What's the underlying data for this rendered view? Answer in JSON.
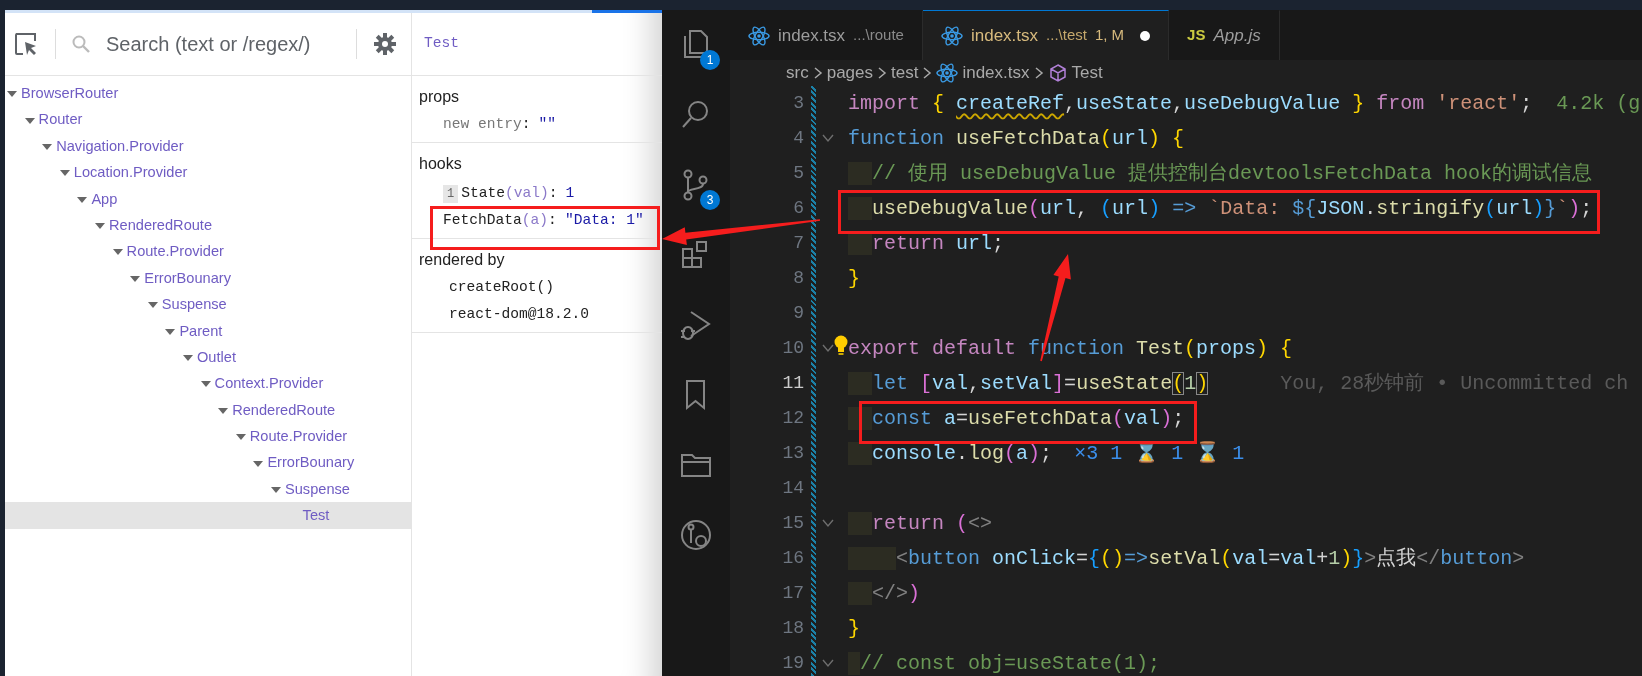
{
  "devtools": {
    "search": {
      "placeholder": "Search (text or /regex/)"
    },
    "tree": [
      {
        "label": "BrowserRouter",
        "expanded": true,
        "selected": false,
        "children": [
          {
            "label": "Router",
            "expanded": true,
            "selected": false,
            "children": [
              {
                "label": "Navigation.Provider",
                "expanded": true,
                "selected": false,
                "children": [
                  {
                    "label": "Location.Provider",
                    "expanded": true,
                    "selected": false,
                    "children": [
                      {
                        "label": "App",
                        "expanded": true,
                        "selected": false,
                        "children": [
                          {
                            "label": "RenderedRoute",
                            "expanded": true,
                            "selected": false,
                            "children": [
                              {
                                "label": "Route.Provider",
                                "expanded": true,
                                "selected": false,
                                "children": [
                                  {
                                    "label": "ErrorBounary",
                                    "expanded": true,
                                    "selected": false,
                                    "children": [
                                      {
                                        "label": "Suspense",
                                        "expanded": true,
                                        "selected": false,
                                        "children": [
                                          {
                                            "label": "Parent",
                                            "expanded": true,
                                            "selected": false,
                                            "children": [
                                              {
                                                "label": "Outlet",
                                                "expanded": true,
                                                "selected": false,
                                                "children": [
                                                  {
                                                    "label": "Context.Provider",
                                                    "expanded": true,
                                                    "selected": false,
                                                    "children": [
                                                      {
                                                        "label": "RenderedRoute",
                                                        "expanded": true,
                                                        "selected": false,
                                                        "children": [
                                                          {
                                                            "label": "Route.Provider",
                                                            "expanded": true,
                                                            "selected": false,
                                                            "children": [
                                                              {
                                                                "label": "ErrorBounary",
                                                                "expanded": true,
                                                                "selected": false,
                                                                "children": [
                                                                  {
                                                                    "label": "Suspense",
                                                                    "expanded": true,
                                                                    "selected": false,
                                                                    "children": [
                                                                      {
                                                                        "label": "Test",
                                                                        "selected": true
                                                                      }
                                                                    ]
                                                                  }
                                                                ]
                                                              }
                                                            ]
                                                          }
                                                        ]
                                                      }
                                                    ]
                                                  }
                                                ]
                                              }
                                            ]
                                          }
                                        ]
                                      }
                                    ]
                                  }
                                ]
                              }
                            ]
                          }
                        ]
                      }
                    ]
                  }
                ]
              }
            ]
          }
        ]
      }
    ],
    "inspector": {
      "component": "Test",
      "sections": [
        {
          "title": "props",
          "rows": [
            {
              "kind": "prop",
              "key": "new entry",
              "sep": ":",
              "value": "\"\""
            }
          ]
        },
        {
          "title": "hooks",
          "rows": [
            {
              "kind": "hook",
              "index": "1",
              "name": "State",
              "arg": "(val)",
              "sep": ":",
              "value": "1"
            },
            {
              "kind": "hook",
              "name": "FetchData",
              "arg": "(a)",
              "sep": ":",
              "value": "\"Data: 1\""
            }
          ]
        },
        {
          "title": "rendered by",
          "rows": [
            {
              "kind": "owner",
              "text": "createRoot()"
            },
            {
              "kind": "owner",
              "text": "react-dom@18.2.0"
            }
          ]
        }
      ]
    }
  },
  "editor": {
    "activity_bar": [
      {
        "kind": "files",
        "badge": "1"
      },
      {
        "kind": "search"
      },
      {
        "kind": "source-control",
        "badge": "3"
      },
      {
        "kind": "extensions"
      },
      {
        "kind": "debug"
      },
      {
        "kind": "bookmark"
      },
      {
        "kind": "folder"
      },
      {
        "kind": "git-graph"
      }
    ],
    "tabs": [
      {
        "icon": {
          "kind": "react"
        },
        "label": "index.tsx",
        "description": "...\\route",
        "selected": false,
        "preview": false,
        "dirty": false
      },
      {
        "icon": {
          "kind": "react"
        },
        "label": "index.tsx",
        "description": "...\\test",
        "status": "1, M",
        "selected": true,
        "preview": false,
        "dirty": true
      },
      {
        "icon": {
          "kind": "js",
          "text": "JS"
        },
        "label": "App.js",
        "selected": false,
        "preview": true,
        "dirty": false
      }
    ],
    "breadcrumb": [
      {
        "kind": "folder",
        "label": "src"
      },
      {
        "kind": "folder",
        "label": "pages"
      },
      {
        "kind": "folder",
        "label": "test"
      },
      {
        "kind": "file",
        "label": "index.tsx"
      },
      {
        "kind": "symbol",
        "label": "Test"
      }
    ],
    "lines": [
      {
        "number": "3",
        "tokens": [
          {
            "kind": "kw",
            "text": "import "
          },
          {
            "kind": "b1",
            "text": "{ "
          },
          {
            "kind": "unused",
            "text": "createRef"
          },
          {
            "kind": "p",
            "text": ","
          },
          {
            "kind": "var",
            "text": "useState"
          },
          {
            "kind": "p",
            "text": ","
          },
          {
            "kind": "var",
            "text": "useDebugValue "
          },
          {
            "kind": "b1",
            "text": "} "
          },
          {
            "kind": "kw",
            "text": "from "
          },
          {
            "kind": "str",
            "text": "'react'"
          },
          {
            "kind": "p",
            "text": ";"
          }
        ],
        "hint": {
          "kind": "size",
          "text": "4.2k (g"
        }
      },
      {
        "number": "4",
        "foldable": true,
        "tokens": [
          {
            "kind": "st",
            "text": "function "
          },
          {
            "kind": "fn",
            "text": "useFetchData"
          },
          {
            "kind": "b1",
            "text": "("
          },
          {
            "kind": "var",
            "text": "url"
          },
          {
            "kind": "b1",
            "text": ") {"
          }
        ]
      },
      {
        "number": "5",
        "tokens": [
          {
            "kind": "cm",
            "text": "  // 使用 useDebugValue 提供控制台devtoolsFetchData hook的调试信息"
          }
        ]
      },
      {
        "number": "6",
        "tokens": [
          {
            "kind": "fn",
            "text": "  useDebugValue"
          },
          {
            "kind": "b2",
            "text": "("
          },
          {
            "kind": "var",
            "text": "url"
          },
          {
            "kind": "p",
            "text": ", "
          },
          {
            "kind": "b3",
            "text": "("
          },
          {
            "kind": "var",
            "text": "url"
          },
          {
            "kind": "b3",
            "text": ") "
          },
          {
            "kind": "st",
            "text": "=> "
          },
          {
            "kind": "str",
            "text": "`Data: "
          },
          {
            "kind": "st",
            "text": "${"
          },
          {
            "kind": "var",
            "text": "JSON"
          },
          {
            "kind": "p",
            "text": "."
          },
          {
            "kind": "fn",
            "text": "stringify"
          },
          {
            "kind": "b3",
            "text": "("
          },
          {
            "kind": "var",
            "text": "url"
          },
          {
            "kind": "b3",
            "text": ")"
          },
          {
            "kind": "st",
            "text": "}"
          },
          {
            "kind": "str",
            "text": "`"
          },
          {
            "kind": "b2",
            "text": ")"
          },
          {
            "kind": "p",
            "text": ";"
          }
        ]
      },
      {
        "number": "7",
        "tokens": [
          {
            "kind": "kw",
            "text": "  return "
          },
          {
            "kind": "var",
            "text": "url"
          },
          {
            "kind": "p",
            "text": ";"
          }
        ]
      },
      {
        "number": "8",
        "tokens": [
          {
            "kind": "b1",
            "text": "}"
          }
        ]
      },
      {
        "number": "9"
      },
      {
        "number": "10",
        "foldable": true,
        "lightbulb": true,
        "tokens": [
          {
            "kind": "kw",
            "text": "export default "
          },
          {
            "kind": "st",
            "text": "function "
          },
          {
            "kind": "fn",
            "text": "Test"
          },
          {
            "kind": "b1",
            "text": "("
          },
          {
            "kind": "var",
            "text": "props"
          },
          {
            "kind": "b1",
            "text": ") {"
          }
        ]
      },
      {
        "number": "11",
        "current": true,
        "tokens": [
          {
            "kind": "st",
            "text": "  let "
          },
          {
            "kind": "b2",
            "text": "["
          },
          {
            "kind": "var",
            "text": "val"
          },
          {
            "kind": "p",
            "text": ","
          },
          {
            "kind": "var",
            "text": "setVal"
          },
          {
            "kind": "b2",
            "text": "]"
          },
          {
            "kind": "p",
            "text": "="
          },
          {
            "kind": "fn",
            "text": "useState"
          },
          {
            "kind": "match",
            "text": "("
          },
          {
            "kind": "num",
            "text": "1"
          },
          {
            "kind": "match",
            "text": ")"
          }
        ],
        "hint": {
          "kind": "blame",
          "text": "You, 28秒钟前 • Uncommitted ch"
        }
      },
      {
        "number": "12",
        "tokens": [
          {
            "kind": "st",
            "text": "  const "
          },
          {
            "kind": "var",
            "text": "a"
          },
          {
            "kind": "p",
            "text": "="
          },
          {
            "kind": "fn",
            "text": "useFetchData"
          },
          {
            "kind": "b2",
            "text": "("
          },
          {
            "kind": "var",
            "text": "val"
          },
          {
            "kind": "b2",
            "text": ")"
          },
          {
            "kind": "p",
            "text": ";"
          }
        ]
      },
      {
        "number": "13",
        "tokens": [
          {
            "kind": "var",
            "text": "  console"
          },
          {
            "kind": "p",
            "text": "."
          },
          {
            "kind": "fn",
            "text": "log"
          },
          {
            "kind": "b2",
            "text": "("
          },
          {
            "kind": "var",
            "text": "a"
          },
          {
            "kind": "b2",
            "text": ")"
          },
          {
            "kind": "p",
            "text": ";"
          }
        ],
        "hint": {
          "kind": "log",
          "text": "×3 1 ⌛ 1 ⌛ 1"
        }
      },
      {
        "number": "14"
      },
      {
        "number": "15",
        "foldable": true,
        "tokens": [
          {
            "kind": "kw",
            "text": "  return "
          },
          {
            "kind": "b2",
            "text": "("
          },
          {
            "kind": "ang",
            "text": "<>"
          }
        ]
      },
      {
        "number": "16",
        "tokens": [
          {
            "kind": "ang",
            "text": "    <"
          },
          {
            "kind": "tag",
            "text": "button "
          },
          {
            "kind": "var",
            "text": "onClick"
          },
          {
            "kind": "p",
            "text": "="
          },
          {
            "kind": "b3",
            "text": "{"
          },
          {
            "kind": "b1",
            "text": "()"
          },
          {
            "kind": "st",
            "text": "=>"
          },
          {
            "kind": "fn",
            "text": "setVal"
          },
          {
            "kind": "b1",
            "text": "("
          },
          {
            "kind": "var",
            "text": "val"
          },
          {
            "kind": "p",
            "text": "="
          },
          {
            "kind": "var",
            "text": "val"
          },
          {
            "kind": "p",
            "text": "+"
          },
          {
            "kind": "num",
            "text": "1"
          },
          {
            "kind": "b1",
            "text": ")"
          },
          {
            "kind": "b3",
            "text": "}"
          },
          {
            "kind": "ang",
            "text": ">"
          },
          {
            "kind": "p",
            "text": "点我"
          },
          {
            "kind": "ang",
            "text": "</"
          },
          {
            "kind": "tag",
            "text": "button"
          },
          {
            "kind": "ang",
            "text": ">"
          }
        ]
      },
      {
        "number": "17",
        "tokens": [
          {
            "kind": "ang",
            "text": "  </>"
          },
          {
            "kind": "b2",
            "text": ")"
          }
        ]
      },
      {
        "number": "18",
        "tokens": [
          {
            "kind": "b1",
            "text": "}"
          }
        ]
      },
      {
        "number": "19",
        "foldable": true,
        "tokens": [
          {
            "kind": "cm",
            "text": " // const obj=useState(1);"
          }
        ]
      }
    ]
  },
  "annotations": [
    {
      "kind": "box"
    },
    {
      "kind": "box"
    },
    {
      "kind": "box"
    },
    {
      "kind": "arrow"
    },
    {
      "kind": "arrow"
    }
  ]
}
